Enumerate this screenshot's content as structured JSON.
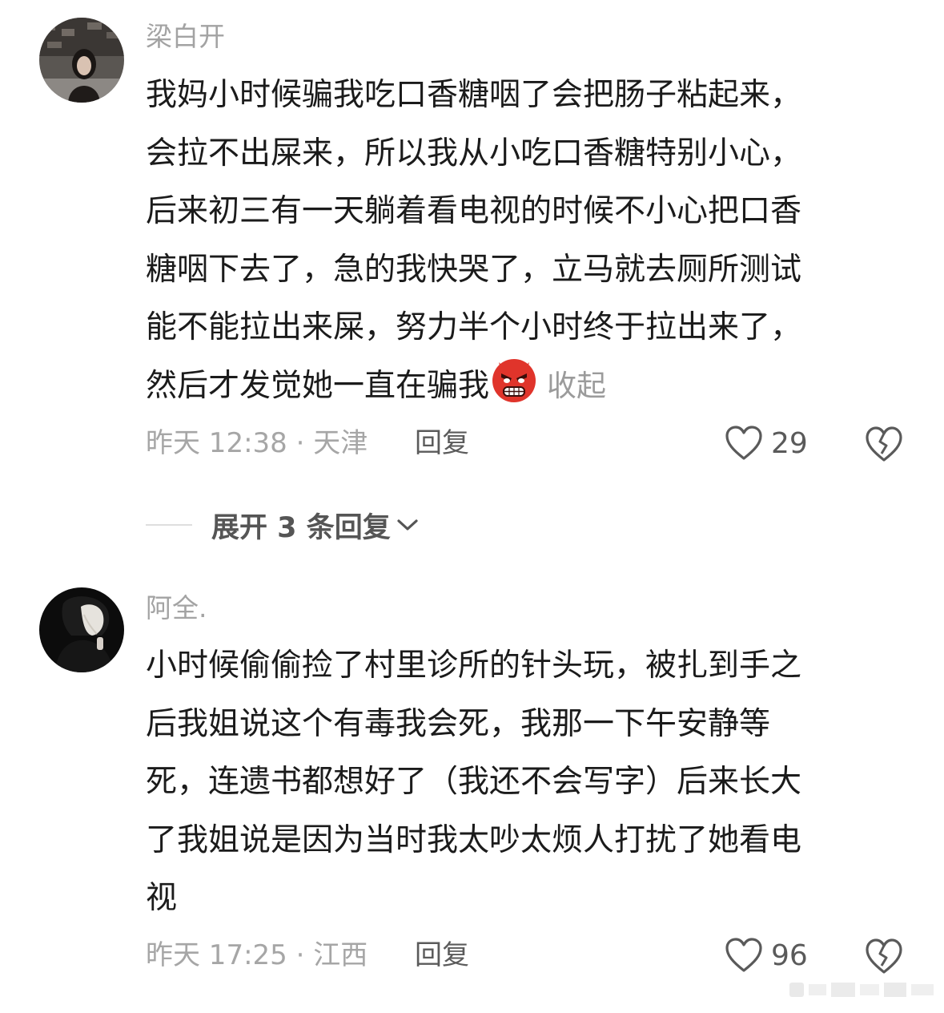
{
  "comments": [
    {
      "username": "梁白开",
      "avatar_icon": "user-avatar-photo",
      "lines": [
        "我妈小时候骗我吃口香糖咽了会把肠子粘起来，",
        "会拉不出屎来，所以我从小吃口香糖特别小心，",
        "后来初三有一天躺着看电视的时候不小心把口香",
        "糖咽下去了，急的我快哭了，立马就去厕所测试",
        "能不能拉出来屎，努力半个小时终于拉出来了，",
        "然后才发觉她一直在骗我"
      ],
      "emoji": "angry-face-emoji",
      "collapse_label": "收起",
      "time_location": "昨天 12:38 · 天津",
      "reply_label": "回复",
      "like_count": "29"
    },
    {
      "username": "阿全.",
      "avatar_icon": "user-avatar-photo",
      "lines": [
        "小时候偷偷捡了村里诊所的针头玩，被扎到手之",
        "后我姐说这个有毒我会死，我那一下午安静等",
        "死，连遗书都想好了（我还不会写字）后来长大",
        "了我姐说是因为当时我太吵太烦人打扰了她看电",
        "视"
      ],
      "time_location": "昨天 17:25 · 江西",
      "reply_label": "回复",
      "like_count": "96"
    }
  ],
  "expand_replies": {
    "label": "展开 3 条回复"
  },
  "colors": {
    "text": "#1b1b1b",
    "muted": "#a3a3a3",
    "emoji_red": "#e0342b"
  }
}
